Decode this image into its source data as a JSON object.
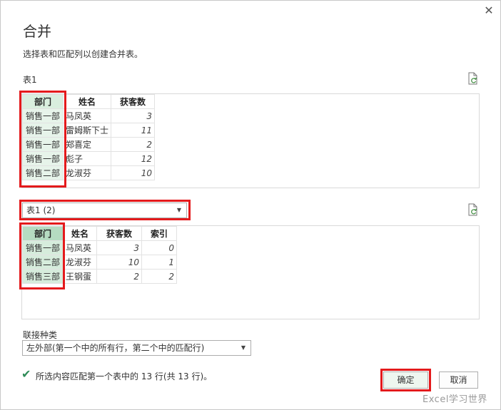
{
  "dialog": {
    "title": "合并",
    "subtitle": "选择表和匹配列以创建合并表。",
    "close_glyph": "✕"
  },
  "table1": {
    "label": "表1",
    "headers": [
      "部门",
      "姓名",
      "获客数"
    ],
    "rows": [
      [
        "销售一部",
        "马凤英",
        "3"
      ],
      [
        "销售一部",
        "雷姆斯下士",
        "11"
      ],
      [
        "销售一部",
        "郑喜定",
        "2"
      ],
      [
        "销售一部",
        "彪子",
        "12"
      ],
      [
        "销售二部",
        "龙淑芬",
        "10"
      ]
    ]
  },
  "table2": {
    "selected": "表1 (2)",
    "headers": [
      "部门",
      "姓名",
      "获客数",
      "索引"
    ],
    "rows": [
      [
        "销售一部",
        "马凤英",
        "3",
        "0"
      ],
      [
        "销售二部",
        "龙淑芬",
        "10",
        "1"
      ],
      [
        "销售三部",
        "王钢蛋",
        "2",
        "2"
      ]
    ]
  },
  "join": {
    "label": "联接种类",
    "selected": "左外部(第一个中的所有行，第二个中的匹配行)"
  },
  "status": {
    "text": "所选内容匹配第一个表中的 13 行(共 13 行)。"
  },
  "buttons": {
    "ok": "确定",
    "cancel": "取消"
  },
  "watermark": "Excel学习世界",
  "icons": {
    "refresh": "refresh-icon",
    "check": "check-icon",
    "dropdown": "chevron-down-icon"
  },
  "colors": {
    "highlight_box": "#e41a1c",
    "selected_column_1": "#e7f4ea",
    "selected_column_2": "#d6ecdc",
    "check_green": "#2e8b57"
  }
}
